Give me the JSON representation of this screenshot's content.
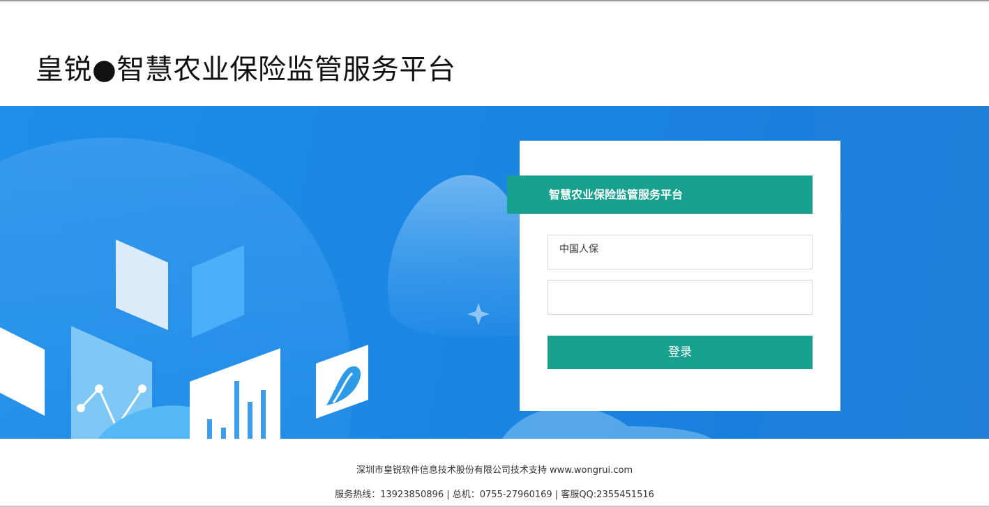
{
  "header": {
    "title": "皇锐●智慧农业保险监管服务平台"
  },
  "login": {
    "title": "智慧农业保险监管服务平台",
    "username_value": "中国人保",
    "password_value": "",
    "submit_label": "登录"
  },
  "footer": {
    "line1": "深圳市皇锐软件信息技术股份有限公司技术支持 www.wongrui.com",
    "line2": "服务热线：13923850896 | 总机：0755-27960169 | 客服QQ:2355451516"
  },
  "colors": {
    "accent_green": "#19a190",
    "banner_blue": "#1b86e3",
    "text_dark": "#333333"
  },
  "icons": {
    "logo_tile": "road-logo-icon",
    "sparkle": "sparkle-icon"
  }
}
